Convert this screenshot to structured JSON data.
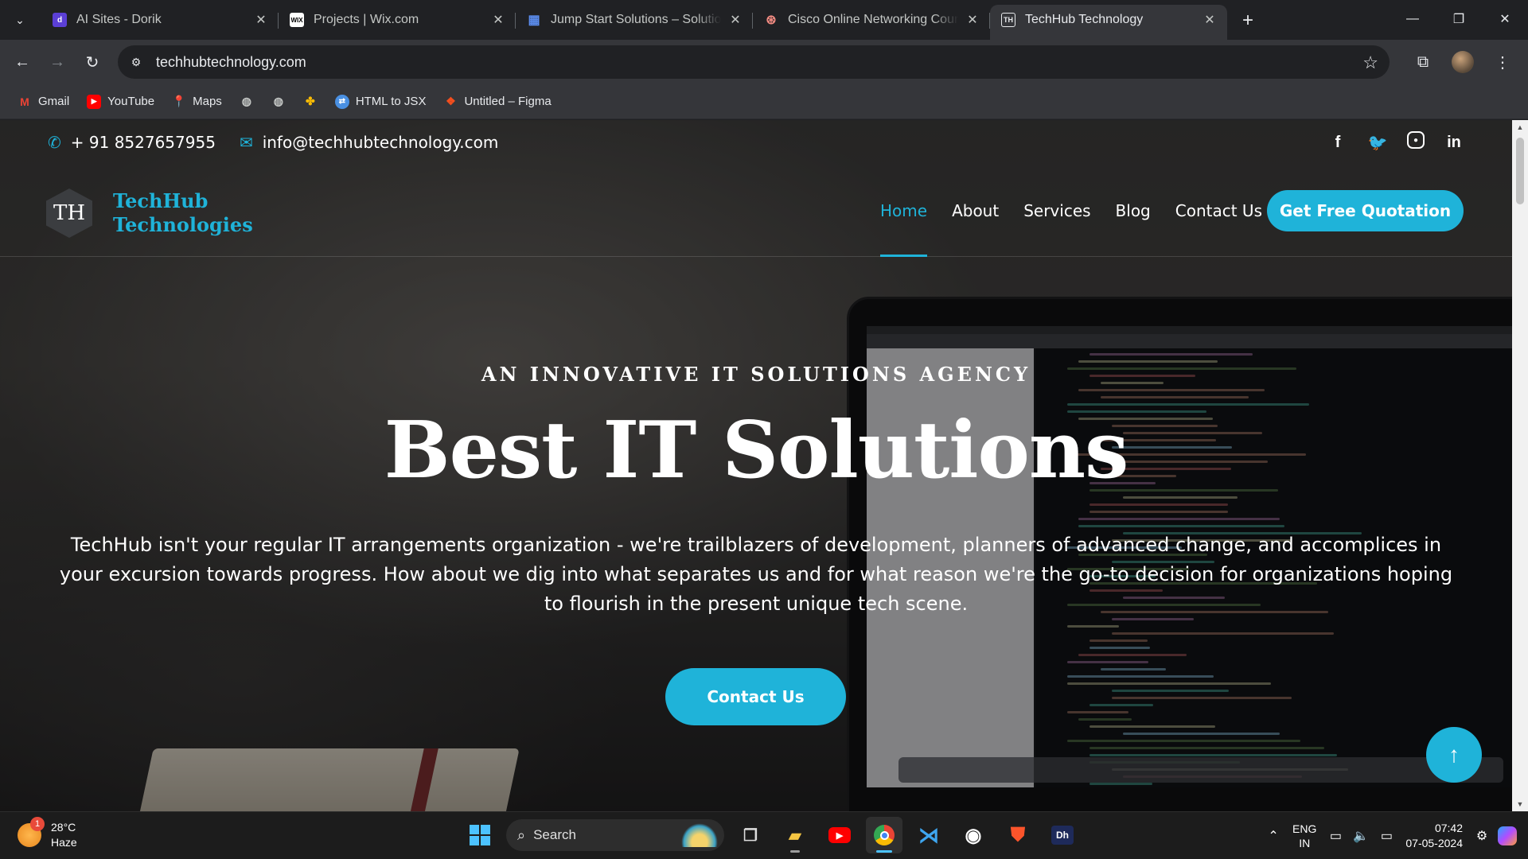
{
  "browser": {
    "tabs": [
      {
        "title": "AI Sites - Dorik",
        "favicon": "dorik-icon",
        "color": "#5b3fd6"
      },
      {
        "title": "Projects | Wix.com",
        "favicon": "wix-icon",
        "color": "#ffffff"
      },
      {
        "title": "Jump Start Solutions – Solutions",
        "favicon": "grid-icon",
        "color": "#5b8def"
      },
      {
        "title": "Cisco Online Networking Course",
        "favicon": "cisco-icon",
        "color": "#e8eaed"
      },
      {
        "title": "TechHub Technology",
        "favicon": "techhub-icon",
        "color": "#e8eaed",
        "active": true
      }
    ],
    "url": "techhubtechnology.com",
    "bookmarks": [
      {
        "label": "Gmail",
        "icon": "gmail-icon"
      },
      {
        "label": "YouTube",
        "icon": "youtube-icon"
      },
      {
        "label": "Maps",
        "icon": "maps-icon"
      },
      {
        "label": "",
        "icon": "globe-icon"
      },
      {
        "label": "",
        "icon": "globe-icon"
      },
      {
        "label": "",
        "icon": "pinwheel-icon"
      },
      {
        "label": "HTML to JSX",
        "icon": "transform-icon"
      },
      {
        "label": "Untitled – Figma",
        "icon": "figma-icon"
      }
    ]
  },
  "site": {
    "phone": "+ 91 8527657955",
    "email": "info@techhubtechnology.com",
    "logo_mark": "TH",
    "logo_line1": "TechHub",
    "logo_line2": "Technologies",
    "nav": [
      "Home",
      "About",
      "Services",
      "Blog",
      "Contact Us"
    ],
    "nav_active": "Home",
    "quote_button": "Get Free Quotation",
    "eyebrow": "AN INNOVATIVE IT SOLUTIONS AGENCY",
    "headline": "Best IT Solutions",
    "description": "TechHub isn't your regular IT arrangements organization - we're trailblazers of development, planners of advanced change, and accomplices in your excursion towards progress. How about we dig into what separates us and for what reason we're the go-to decision for organizations hoping to flourish in the present unique tech scene.",
    "cta": "Contact Us",
    "accent": "#1fb3d9"
  },
  "taskbar": {
    "temperature": "28°C",
    "condition": "Haze",
    "weather_badge": "1",
    "search_label": "Search",
    "lang": "ENG",
    "region": "IN",
    "time": "07:42",
    "date": "07-05-2024"
  }
}
